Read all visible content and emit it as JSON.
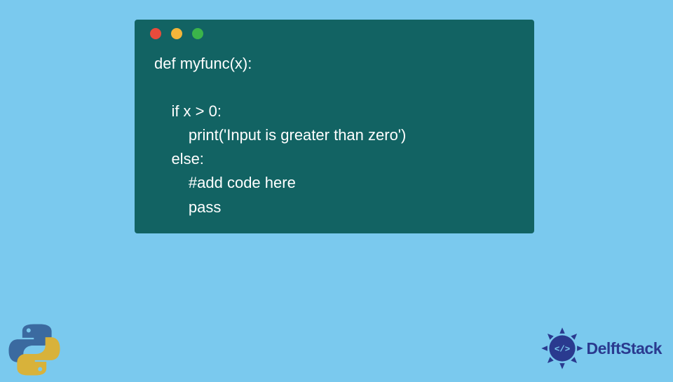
{
  "code": {
    "line1": "def myfunc(x):",
    "line2": "",
    "line3": "    if x > 0:",
    "line4": "        print('Input is greater than zero')",
    "line5": "    else:",
    "line6": "        #add code here",
    "line7": "        pass"
  },
  "brand": {
    "name": "DelftStack"
  },
  "colors": {
    "background": "#7ac9ee",
    "window": "#126363",
    "brand_text": "#2a3a8f",
    "dot_red": "#e94b3c",
    "dot_yellow": "#f3b53a",
    "dot_green": "#3bb44a"
  }
}
